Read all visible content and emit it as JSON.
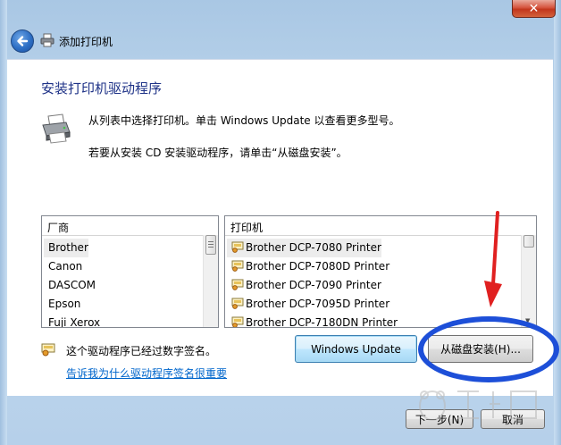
{
  "window": {
    "title": "添加打印机",
    "close_label": "✕"
  },
  "page": {
    "heading": "安装打印机驱动程序",
    "info_line1": "从列表中选择打印机。单击 Windows Update 以查看更多型号。",
    "info_line2": "若要从安装 CD 安装驱动程序，请单击“从磁盘安装”。"
  },
  "manufacturers": {
    "header": "厂商",
    "items": [
      "Brother",
      "Canon",
      "DASCOM",
      "Epson",
      "Fuji Xerox"
    ],
    "selected_index": 0
  },
  "printers": {
    "header": "打印机",
    "items": [
      "Brother DCP-7080 Printer",
      "Brother DCP-7080D Printer",
      "Brother DCP-7090 Printer",
      "Brother DCP-7095D Printer",
      "Brother DCP-7180DN Printer"
    ],
    "selected_index": 0
  },
  "buttons": {
    "windows_update": "Windows Update",
    "have_disk": "从磁盘安装(H)...",
    "next": "下一步(N)",
    "cancel": "取消"
  },
  "signature": {
    "text": "这个驱动程序已经过数字签名。",
    "link": "告诉我为什么驱动程序签名很重要"
  },
  "colors": {
    "heading": "#1e3287",
    "link": "#0066cc",
    "annotation": "#1d4fd8",
    "arrow": "#e02020"
  }
}
